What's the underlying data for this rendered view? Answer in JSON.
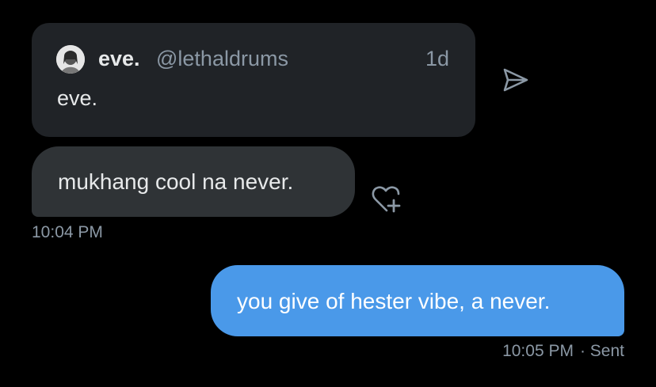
{
  "quote": {
    "name": "eve.",
    "handle": "@lethaldrums",
    "time": "1d",
    "text": "eve."
  },
  "icons": {
    "share": "send-arrow-icon",
    "react": "heart-plus-icon",
    "avatar": "user-avatar"
  },
  "messages": {
    "received": {
      "text": "mukhang cool na never.",
      "time": "10:04 PM"
    },
    "sent": {
      "text": "you give of hester vibe, a never.",
      "time": "10:05 PM",
      "status": "· Sent"
    }
  },
  "colors": {
    "background": "#000000",
    "card": "#202327",
    "received_bubble": "#2f3336",
    "sent_bubble": "#4a99e9",
    "secondary_text": "#8b98a5"
  }
}
